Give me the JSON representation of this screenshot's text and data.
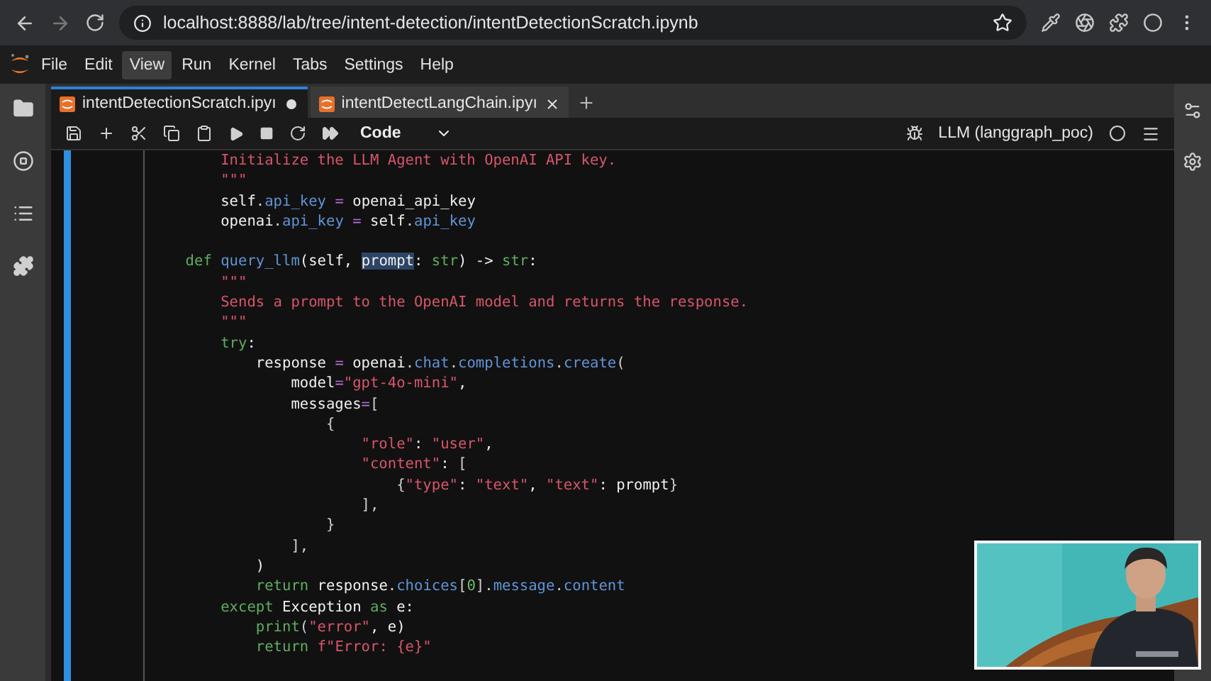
{
  "browser": {
    "url": "localhost:8888/lab/tree/intent-detection/intentDetectionScratch.ipynb"
  },
  "menu": [
    {
      "label": "File",
      "selected": false
    },
    {
      "label": "Edit",
      "selected": false
    },
    {
      "label": "View",
      "selected": true
    },
    {
      "label": "Run",
      "selected": false
    },
    {
      "label": "Kernel",
      "selected": false
    },
    {
      "label": "Tabs",
      "selected": false
    },
    {
      "label": "Settings",
      "selected": false
    },
    {
      "label": "Help",
      "selected": false
    }
  ],
  "tabs": [
    {
      "label": "intentDetectionScratch.ipyı",
      "selected": true,
      "modified": true
    },
    {
      "label": "intentDetectLangChain.ipyı",
      "selected": false,
      "modified": false
    }
  ],
  "toolbar": {
    "cell_type": "Code",
    "kernel": "LLM (langgraph_poc)"
  },
  "code": [
    {
      "kind": "code",
      "tokens": [
        {
          "text": "        Initialize the LLM Agent with OpenAI API key.",
          "kind": "string"
        }
      ]
    },
    {
      "kind": "code",
      "tokens": [
        {
          "text": "        \"\"\"",
          "kind": "string"
        }
      ]
    },
    {
      "kind": "code",
      "tokens": [
        {
          "text": "        self",
          "kind": "plain"
        },
        {
          "text": ".",
          "kind": "punct"
        },
        {
          "text": "api_key",
          "kind": "attr"
        },
        {
          "text": " = ",
          "kind": "op"
        },
        {
          "text": "openai_api_key",
          "kind": "plain"
        }
      ]
    },
    {
      "kind": "code",
      "tokens": [
        {
          "text": "        openai",
          "kind": "plain"
        },
        {
          "text": ".",
          "kind": "punct"
        },
        {
          "text": "api_key",
          "kind": "attr"
        },
        {
          "text": " = ",
          "kind": "op"
        },
        {
          "text": "self",
          "kind": "plain"
        },
        {
          "text": ".",
          "kind": "punct"
        },
        {
          "text": "api_key",
          "kind": "attr"
        }
      ]
    },
    {
      "kind": "blank"
    },
    {
      "kind": "code",
      "tokens": [
        {
          "text": "    def ",
          "kind": "keyword"
        },
        {
          "text": "query_llm",
          "kind": "function"
        },
        {
          "text": "(self, ",
          "kind": "plain"
        },
        {
          "text": "prompt",
          "kind": "match"
        },
        {
          "text": ": ",
          "kind": "plain"
        },
        {
          "text": "str",
          "kind": "builtin"
        },
        {
          "text": ") -> ",
          "kind": "plain"
        },
        {
          "text": "str",
          "kind": "builtin"
        },
        {
          "text": ":",
          "kind": "plain"
        }
      ]
    },
    {
      "kind": "code",
      "tokens": [
        {
          "text": "        \"\"\"",
          "kind": "string"
        }
      ]
    },
    {
      "kind": "code",
      "tokens": [
        {
          "text": "        Sends a prompt to the OpenAI model and returns the response.",
          "kind": "string"
        }
      ]
    },
    {
      "kind": "code",
      "tokens": [
        {
          "text": "        \"\"\"",
          "kind": "string"
        }
      ]
    },
    {
      "kind": "code",
      "tokens": [
        {
          "text": "        try",
          "kind": "keyword"
        },
        {
          "text": ":",
          "kind": "plain"
        }
      ]
    },
    {
      "kind": "code",
      "tokens": [
        {
          "text": "            response",
          "kind": "plain"
        },
        {
          "text": " = ",
          "kind": "op"
        },
        {
          "text": "openai",
          "kind": "plain"
        },
        {
          "text": ".",
          "kind": "punct"
        },
        {
          "text": "chat",
          "kind": "attr"
        },
        {
          "text": ".",
          "kind": "punct"
        },
        {
          "text": "completions",
          "kind": "attr"
        },
        {
          "text": ".",
          "kind": "punct"
        },
        {
          "text": "create",
          "kind": "attr"
        },
        {
          "text": "(",
          "kind": "punct"
        }
      ]
    },
    {
      "kind": "code",
      "tokens": [
        {
          "text": "                model",
          "kind": "plain"
        },
        {
          "text": "=",
          "kind": "op"
        },
        {
          "text": "\"gpt-4o-mini\"",
          "kind": "string"
        },
        {
          "text": ",",
          "kind": "plain"
        }
      ]
    },
    {
      "kind": "code",
      "tokens": [
        {
          "text": "                messages",
          "kind": "plain"
        },
        {
          "text": "=",
          "kind": "op"
        },
        {
          "text": "[",
          "kind": "punct"
        }
      ]
    },
    {
      "kind": "code",
      "tokens": [
        {
          "text": "                    {",
          "kind": "punct"
        }
      ]
    },
    {
      "kind": "code",
      "tokens": [
        {
          "text": "                        \"role\"",
          "kind": "string"
        },
        {
          "text": ": ",
          "kind": "plain"
        },
        {
          "text": "\"user\"",
          "kind": "string"
        },
        {
          "text": ",",
          "kind": "plain"
        }
      ]
    },
    {
      "kind": "code",
      "tokens": [
        {
          "text": "                        \"content\"",
          "kind": "string"
        },
        {
          "text": ": ",
          "kind": "plain"
        },
        {
          "text": "[",
          "kind": "punct"
        }
      ]
    },
    {
      "kind": "code",
      "tokens": [
        {
          "text": "                            {",
          "kind": "punct"
        },
        {
          "text": "\"type\"",
          "kind": "string"
        },
        {
          "text": ": ",
          "kind": "plain"
        },
        {
          "text": "\"text\"",
          "kind": "string"
        },
        {
          "text": ", ",
          "kind": "plain"
        },
        {
          "text": "\"text\"",
          "kind": "string"
        },
        {
          "text": ": prompt",
          "kind": "plain"
        },
        {
          "text": "}",
          "kind": "punct"
        }
      ]
    },
    {
      "kind": "code",
      "tokens": [
        {
          "text": "                        ],",
          "kind": "punct"
        }
      ]
    },
    {
      "kind": "code",
      "tokens": [
        {
          "text": "                    }",
          "kind": "punct"
        }
      ]
    },
    {
      "kind": "code",
      "tokens": [
        {
          "text": "                ],",
          "kind": "punct"
        }
      ]
    },
    {
      "kind": "code",
      "tokens": [
        {
          "text": "            )",
          "kind": "plain"
        }
      ]
    },
    {
      "kind": "code",
      "tokens": [
        {
          "text": "            return",
          "kind": "keyword"
        },
        {
          "text": " response",
          "kind": "plain"
        },
        {
          "text": ".",
          "kind": "punct"
        },
        {
          "text": "choices",
          "kind": "attr"
        },
        {
          "text": "[",
          "kind": "punct"
        },
        {
          "text": "0",
          "kind": "number"
        },
        {
          "text": "]",
          "kind": "punct"
        },
        {
          "text": ".",
          "kind": "punct"
        },
        {
          "text": "message",
          "kind": "attr"
        },
        {
          "text": ".",
          "kind": "punct"
        },
        {
          "text": "content",
          "kind": "attr"
        }
      ]
    },
    {
      "kind": "code",
      "tokens": [
        {
          "text": "        except",
          "kind": "keyword"
        },
        {
          "text": " Exception ",
          "kind": "plain"
        },
        {
          "text": "as",
          "kind": "keyword"
        },
        {
          "text": " e:",
          "kind": "plain"
        }
      ]
    },
    {
      "kind": "code",
      "tokens": [
        {
          "text": "            print",
          "kind": "builtin"
        },
        {
          "text": "(",
          "kind": "punct"
        },
        {
          "text": "\"error\"",
          "kind": "string"
        },
        {
          "text": ", e)",
          "kind": "plain"
        }
      ]
    },
    {
      "kind": "code",
      "tokens": [
        {
          "text": "            return",
          "kind": "keyword"
        },
        {
          "text": " f\"Error: {e}\"",
          "kind": "string"
        }
      ]
    }
  ]
}
